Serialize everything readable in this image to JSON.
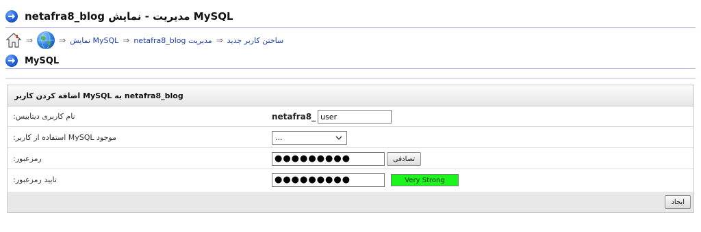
{
  "header": {
    "title": "netafra8_blog مدیریت - نمایش MySQL"
  },
  "breadcrumb": {
    "sep": "⇒",
    "items": [
      {
        "label": "نمایش MySQL"
      },
      {
        "label": "netafra8_blog مدیریت"
      },
      {
        "label": "ساختن کاربر جدید"
      }
    ]
  },
  "section": {
    "title": "MySQL"
  },
  "form": {
    "title": "اضافه کردن کاربر MySQL به netafra8_blog",
    "db_username_label": ":نام کاربری دیتابیس",
    "db_user_prefix": "netafra8_",
    "db_user_value": "user",
    "existing_user_label": ":استفاده از کاربر MySQL موجود",
    "existing_user_selected": "...",
    "password_label": ":رمزعبور",
    "password_value": "●●●●●●●●●",
    "random_button": "تصادفی",
    "confirm_label": ":تایید رمزعبور",
    "confirm_value": "●●●●●●●●●",
    "strength_text": "Very Strong",
    "strength_color": "#1cf51c",
    "submit_button": "ایجاد"
  },
  "colors": {
    "link": "#1b3fa6",
    "rule": "#b8b8ea"
  }
}
